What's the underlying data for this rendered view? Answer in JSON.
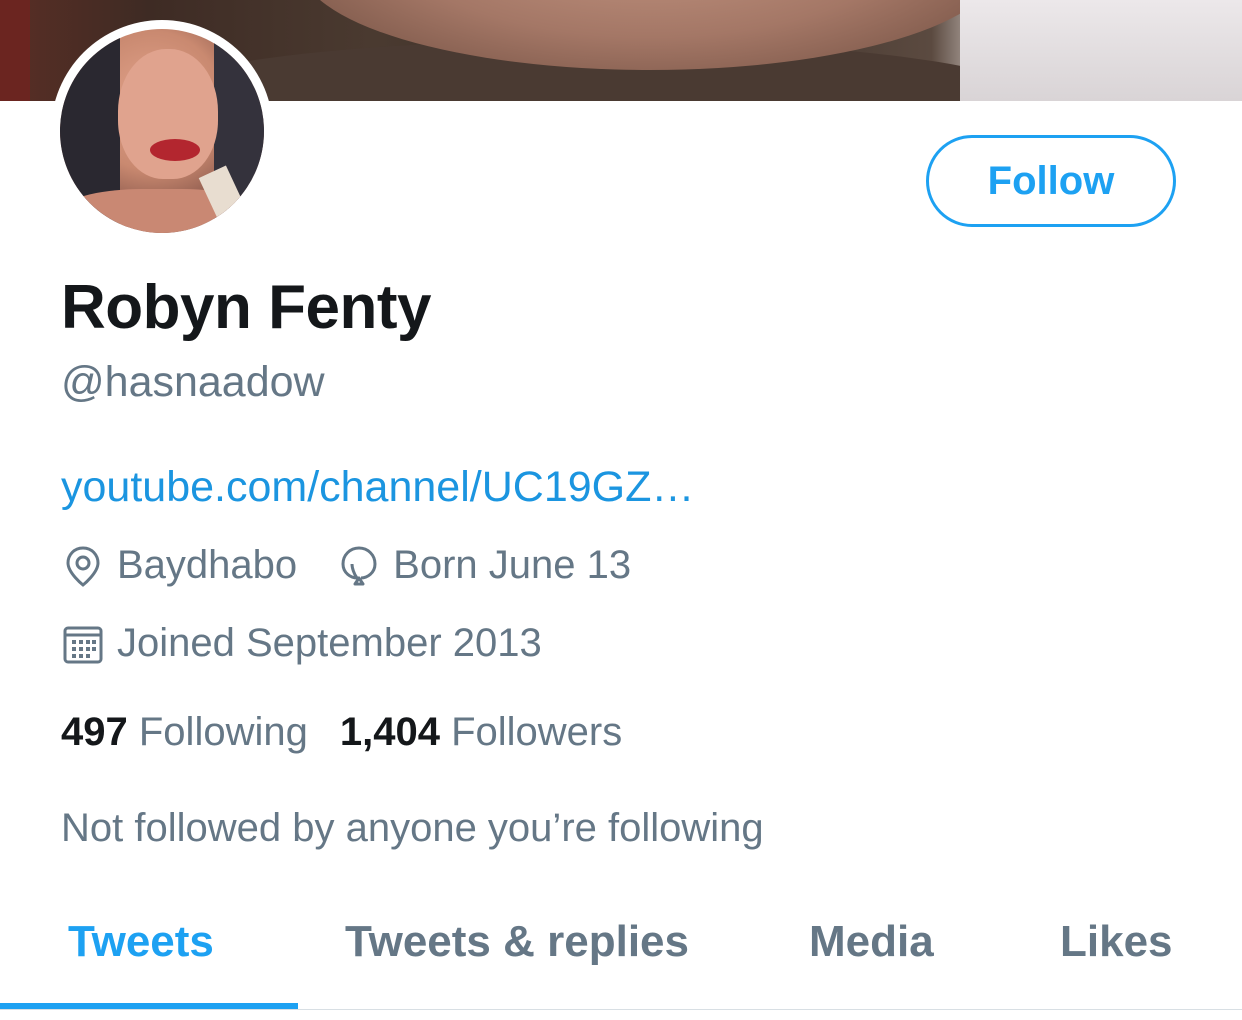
{
  "profile": {
    "follow_label": "Follow",
    "display_name": "Robyn Fenty",
    "handle": "@hasnaadow",
    "website": "youtube.com/channel/UC19GZ…",
    "location": "Baydhabo",
    "birthday": "Born June 13",
    "joined": "Joined September 2013",
    "following_count": "497",
    "following_label": "Following",
    "followers_count": "1,404",
    "followers_label": "Followers",
    "mutual_note": "Not followed by anyone you’re following"
  },
  "tabs": [
    {
      "label": "Tweets",
      "active": true
    },
    {
      "label": "Tweets & replies",
      "active": false
    },
    {
      "label": "Media",
      "active": false
    },
    {
      "label": "Likes",
      "active": false
    }
  ],
  "icons": {
    "location": "location-pin-icon",
    "birthday": "balloon-icon",
    "joined": "calendar-icon"
  },
  "colors": {
    "accent": "#1da1f2",
    "link": "#1b95e0",
    "text_primary": "#14171a",
    "text_secondary": "#657786"
  }
}
